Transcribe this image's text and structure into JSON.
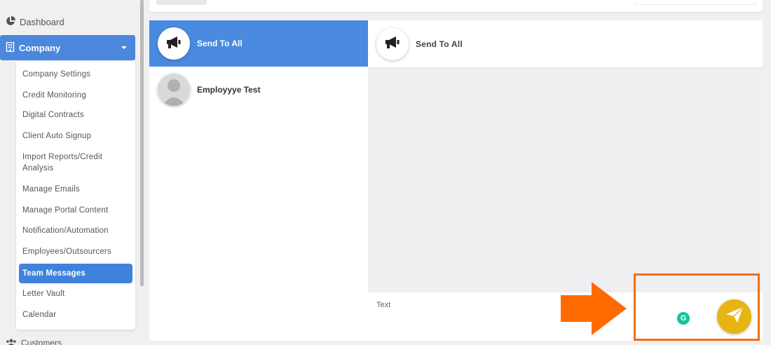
{
  "sidebar": {
    "dashboard_label": "Dashboard",
    "company_label": "Company",
    "submenu": [
      "Company Settings",
      "Credit Monitoring",
      "Digital Contracts",
      "Client Auto Signup",
      "Import Reports/Credit Analysis",
      "Manage Emails",
      "Manage Portal Content",
      "Notification/Automation",
      "Employees/Outsourcers",
      "Team Messages",
      "Letter Vault",
      "Calendar"
    ],
    "active_item": "Team Messages",
    "customers_label": "Customers"
  },
  "contacts": [
    {
      "name": "Send To All",
      "icon": "megaphone-icon",
      "active": true
    },
    {
      "name": "Employyye Test",
      "icon": "user-avatar",
      "active": false
    }
  ],
  "chat": {
    "title": "Send To All",
    "icon": "megaphone-icon",
    "input_placeholder": "Text",
    "grammarly_label": "G"
  },
  "colors": {
    "primary": "#4a8ae0",
    "send_button": "#e6b513",
    "annotation": "#f26f16",
    "grammarly": "#15c39a"
  }
}
